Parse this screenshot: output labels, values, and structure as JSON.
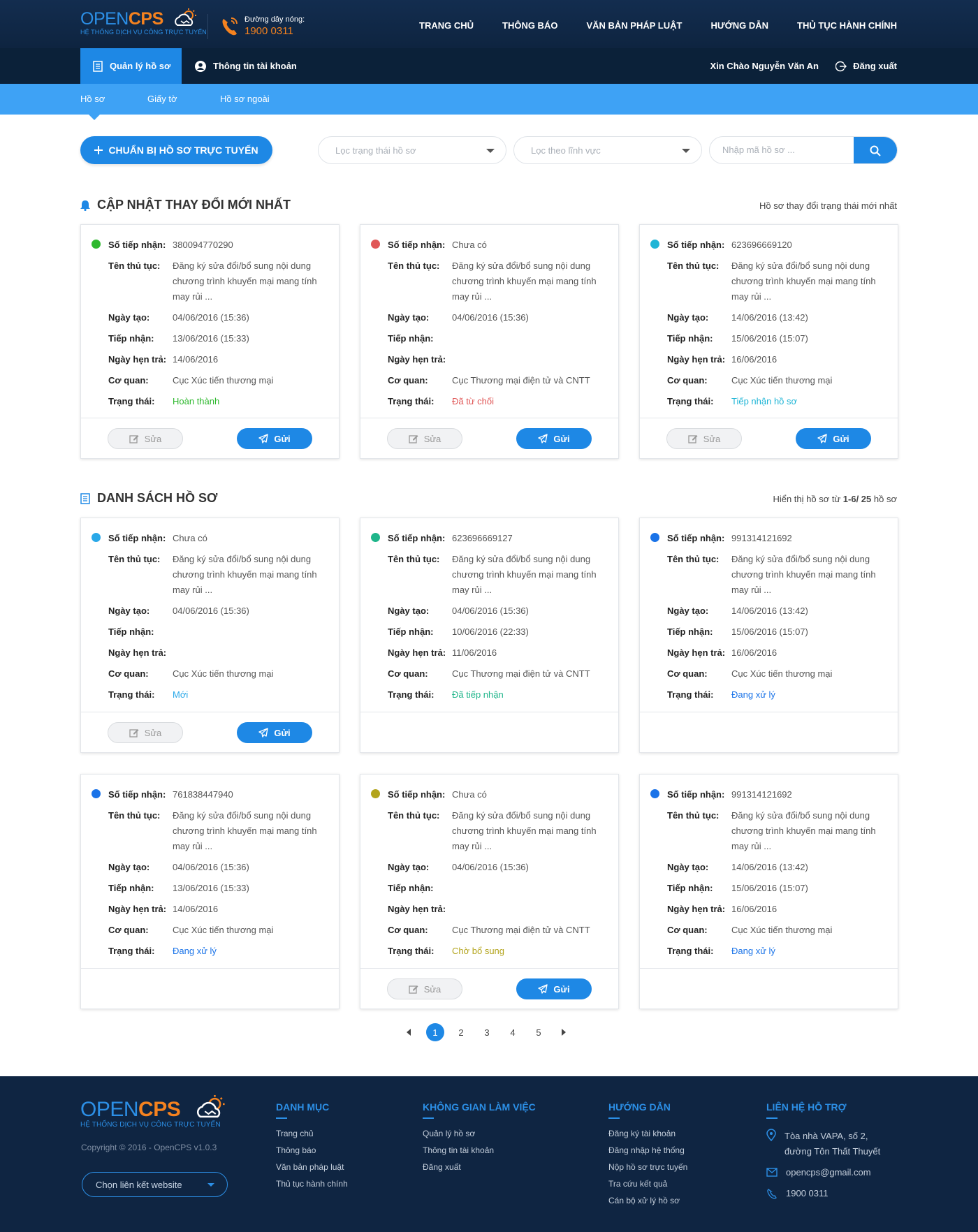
{
  "brand": {
    "logo_open": "OPEN",
    "logo_cps": "CPS",
    "tagline": "HỆ THỐNG DỊCH VỤ CÔNG TRỰC TUYẾN"
  },
  "hotline": {
    "label": "Đường dây nóng:",
    "number": "1900 0311"
  },
  "topnav": [
    "TRANG CHỦ",
    "THÔNG BÁO",
    "VĂN BẢN PHÁP LUẬT",
    "HƯỚNG DẪN",
    "THỦ TỤC HÀNH CHÍNH"
  ],
  "account_bar": {
    "tab_manage": "Quản lý hồ sơ",
    "tab_account": "Thông tin tài khoản",
    "greeting": "Xin Chào Nguyễn Văn An",
    "logout": "Đăng xuất"
  },
  "subnav": [
    "Hồ sơ",
    "Giấy tờ",
    "Hồ sơ ngoài"
  ],
  "toolbar": {
    "prepare_button": "CHUẨN BỊ HỒ SƠ TRỰC TUYẾN",
    "status_filter": "Lọc trạng thái hồ sơ",
    "field_filter": "Lọc theo lĩnh vực",
    "search_placeholder": "Nhập mã hồ sơ ..."
  },
  "labels": {
    "so_tiep_nhan": "Số tiếp nhận:",
    "ten_thu_tuc": "Tên thủ tục:",
    "ngay_tao": "Ngày tạo:",
    "tiep_nhan": "Tiếp nhận:",
    "ngay_hen_tra": "Ngày hẹn trả:",
    "co_quan": "Cơ quan:",
    "trang_thai": "Trạng thái:",
    "edit": "Sửa",
    "send": "Gửi"
  },
  "updates": {
    "title": "CẬP NHẬT THAY ĐỔI MỚI NHẤT",
    "right": "Hồ sơ thay đổi trạng thái mới nhất",
    "cards": [
      {
        "dot": "#2eb82e",
        "so": "380094770290",
        "ten": "Đăng ký sửa đổi/bổ sung nội dung chương trình khuyến mại mang tính may rủi ...",
        "tao": "04/06/2016 (15:36)",
        "tiep": "13/06/2016 (15:33)",
        "hen": "14/06/2016",
        "cq": "Cục Xúc tiến thương mại",
        "tt": "Hoàn thành",
        "tt_color": "#2eb82e",
        "actions": true
      },
      {
        "dot": "#e05757",
        "so": "Chưa có",
        "ten": "Đăng ký sửa đổi/bổ sung nội dung chương trình khuyến mại mang tính may rủi ...",
        "tao": "04/06/2016 (15:36)",
        "tiep": "",
        "hen": "",
        "cq": "Cục Thương mại điện tử và CNTT",
        "tt": "Đã từ chối",
        "tt_color": "#e05757",
        "actions": true
      },
      {
        "dot": "#1fb5d6",
        "so": "623696669120",
        "ten": "Đăng ký sửa đổi/bổ sung nội dung chương trình khuyến mại mang tính may rủi ...",
        "tao": "14/06/2016 (13:42)",
        "tiep": "15/06/2016 (15:07)",
        "hen": "16/06/2016",
        "cq": "Cục Xúc tiến thương mại",
        "tt": "Tiếp nhận hồ sơ",
        "tt_color": "#1fb5d6",
        "actions": true
      }
    ]
  },
  "list": {
    "title": "DANH SÁCH HỒ SƠ",
    "right_prefix": "Hiển thị hồ sơ từ",
    "right_range": "1-6/ 25",
    "right_suffix": "hồ sơ",
    "cards": [
      {
        "dot": "#29a8e8",
        "so": "Chưa có",
        "ten": "Đăng ký sửa đổi/bổ sung nội dung chương trình khuyến mại mang tính may rủi ...",
        "tao": "04/06/2016 (15:36)",
        "tiep": "",
        "hen": "",
        "cq": "Cục Xúc tiến thương mại",
        "tt": "Mới",
        "tt_color": "#29a8e8",
        "actions": true
      },
      {
        "dot": "#1fb58a",
        "so": "623696669127",
        "ten": "Đăng ký sửa đổi/bổ sung nội dung chương trình khuyến mại mang tính may rủi ...",
        "tao": "04/06/2016 (15:36)",
        "tiep": "10/06/2016 (22:33)",
        "hen": "11/06/2016",
        "cq": "Cục Thương mại điện tử và CNTT",
        "tt": "Đã tiếp nhận",
        "tt_color": "#1fb58a",
        "actions": false
      },
      {
        "dot": "#1a73e8",
        "so": "991314121692",
        "ten": "Đăng ký sửa đổi/bổ sung nội dung chương trình khuyến mại mang tính may rủi ...",
        "tao": "14/06/2016 (13:42)",
        "tiep": "15/06/2016 (15:07)",
        "hen": "16/06/2016",
        "cq": "Cục Xúc tiến thương mại",
        "tt": "Đang xử lý",
        "tt_color": "#1a73e8",
        "actions": false
      },
      {
        "dot": "#1a73e8",
        "so": "761838447940",
        "ten": "Đăng ký sửa đổi/bổ sung nội dung chương trình khuyến mại mang tính may rủi ...",
        "tao": "04/06/2016 (15:36)",
        "tiep": "13/06/2016 (15:33)",
        "hen": "14/06/2016",
        "cq": "Cục Xúc tiến thương mại",
        "tt": "Đang xử lý",
        "tt_color": "#1a73e8",
        "actions": false
      },
      {
        "dot": "#b3a41c",
        "so": "Chưa có",
        "ten": "Đăng ký sửa đổi/bổ sung nội dung chương trình khuyến mại mang tính may rủi ...",
        "tao": "04/06/2016 (15:36)",
        "tiep": "",
        "hen": "",
        "cq": "Cục Thương mại điện tử và CNTT",
        "tt": "Chờ bổ sung",
        "tt_color": "#b3a41c",
        "actions": true
      },
      {
        "dot": "#1a73e8",
        "so": "991314121692",
        "ten": "Đăng ký sửa đổi/bổ sung nội dung chương trình khuyến mại mang tính may rủi ...",
        "tao": "14/06/2016 (13:42)",
        "tiep": "15/06/2016 (15:07)",
        "hen": "16/06/2016",
        "cq": "Cục Xúc tiến thương mại",
        "tt": "Đang xử lý",
        "tt_color": "#1a73e8",
        "actions": false
      }
    ]
  },
  "pagination": {
    "pages": [
      "1",
      "2",
      "3",
      "4",
      "5"
    ],
    "current": "1"
  },
  "footer": {
    "copyright": "Copyright © 2016 - OpenCPS v1.0.3",
    "link_select": "Chọn liên kết website",
    "col1": {
      "title": "DANH MỤC",
      "items": [
        "Trang chủ",
        "Thông báo",
        "Văn bản pháp luật",
        "Thủ tục hành chính"
      ]
    },
    "col2": {
      "title": "KHÔNG GIAN LÀM VIỆC",
      "items": [
        "Quản lý hồ sơ",
        "Thông tin tài khoản",
        "Đăng xuất"
      ]
    },
    "col3": {
      "title": "HƯỚNG DẪN",
      "items": [
        "Đăng ký tài khoản",
        "Đăng nhập hệ thống",
        "Nộp hồ sơ trực tuyến",
        "Tra cứu kết quả",
        "Cán bộ xử lý hồ sơ"
      ]
    },
    "col4": {
      "title": "LIÊN HỆ HỖ TRỢ",
      "address_line1": "Tòa nhà VAPA, số 2,",
      "address_line2": "đường Tôn Thất Thuyết",
      "email": "opencps@gmail.com",
      "phone": "1900 0311"
    }
  },
  "colors": {
    "primary": "#1e88e5",
    "navy": "#0f2542",
    "accent": "#f5821f",
    "subnav": "#3ea2f5"
  }
}
